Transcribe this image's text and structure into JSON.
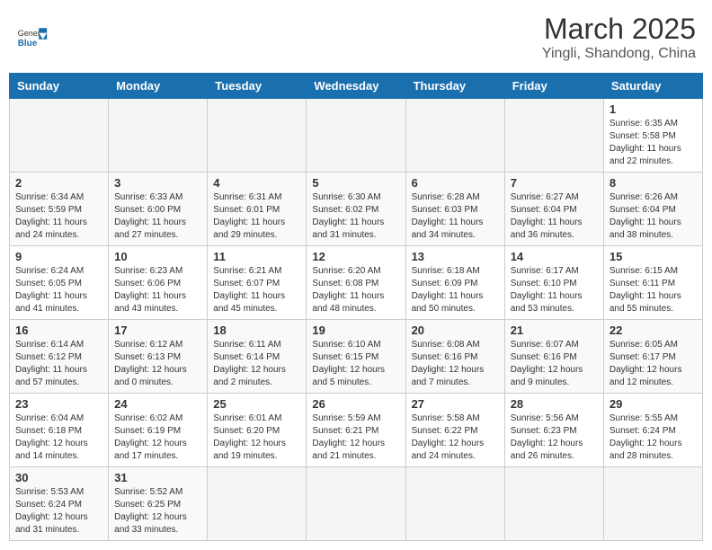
{
  "header": {
    "logo_general": "General",
    "logo_blue": "Blue",
    "month": "March 2025",
    "location": "Yingli, Shandong, China"
  },
  "days_of_week": [
    "Sunday",
    "Monday",
    "Tuesday",
    "Wednesday",
    "Thursday",
    "Friday",
    "Saturday"
  ],
  "weeks": [
    [
      {
        "day": "",
        "info": ""
      },
      {
        "day": "",
        "info": ""
      },
      {
        "day": "",
        "info": ""
      },
      {
        "day": "",
        "info": ""
      },
      {
        "day": "",
        "info": ""
      },
      {
        "day": "",
        "info": ""
      },
      {
        "day": "1",
        "info": "Sunrise: 6:35 AM\nSunset: 5:58 PM\nDaylight: 11 hours\nand 22 minutes."
      }
    ],
    [
      {
        "day": "2",
        "info": "Sunrise: 6:34 AM\nSunset: 5:59 PM\nDaylight: 11 hours\nand 24 minutes."
      },
      {
        "day": "3",
        "info": "Sunrise: 6:33 AM\nSunset: 6:00 PM\nDaylight: 11 hours\nand 27 minutes."
      },
      {
        "day": "4",
        "info": "Sunrise: 6:31 AM\nSunset: 6:01 PM\nDaylight: 11 hours\nand 29 minutes."
      },
      {
        "day": "5",
        "info": "Sunrise: 6:30 AM\nSunset: 6:02 PM\nDaylight: 11 hours\nand 31 minutes."
      },
      {
        "day": "6",
        "info": "Sunrise: 6:28 AM\nSunset: 6:03 PM\nDaylight: 11 hours\nand 34 minutes."
      },
      {
        "day": "7",
        "info": "Sunrise: 6:27 AM\nSunset: 6:04 PM\nDaylight: 11 hours\nand 36 minutes."
      },
      {
        "day": "8",
        "info": "Sunrise: 6:26 AM\nSunset: 6:04 PM\nDaylight: 11 hours\nand 38 minutes."
      }
    ],
    [
      {
        "day": "9",
        "info": "Sunrise: 6:24 AM\nSunset: 6:05 PM\nDaylight: 11 hours\nand 41 minutes."
      },
      {
        "day": "10",
        "info": "Sunrise: 6:23 AM\nSunset: 6:06 PM\nDaylight: 11 hours\nand 43 minutes."
      },
      {
        "day": "11",
        "info": "Sunrise: 6:21 AM\nSunset: 6:07 PM\nDaylight: 11 hours\nand 45 minutes."
      },
      {
        "day": "12",
        "info": "Sunrise: 6:20 AM\nSunset: 6:08 PM\nDaylight: 11 hours\nand 48 minutes."
      },
      {
        "day": "13",
        "info": "Sunrise: 6:18 AM\nSunset: 6:09 PM\nDaylight: 11 hours\nand 50 minutes."
      },
      {
        "day": "14",
        "info": "Sunrise: 6:17 AM\nSunset: 6:10 PM\nDaylight: 11 hours\nand 53 minutes."
      },
      {
        "day": "15",
        "info": "Sunrise: 6:15 AM\nSunset: 6:11 PM\nDaylight: 11 hours\nand 55 minutes."
      }
    ],
    [
      {
        "day": "16",
        "info": "Sunrise: 6:14 AM\nSunset: 6:12 PM\nDaylight: 11 hours\nand 57 minutes."
      },
      {
        "day": "17",
        "info": "Sunrise: 6:12 AM\nSunset: 6:13 PM\nDaylight: 12 hours\nand 0 minutes."
      },
      {
        "day": "18",
        "info": "Sunrise: 6:11 AM\nSunset: 6:14 PM\nDaylight: 12 hours\nand 2 minutes."
      },
      {
        "day": "19",
        "info": "Sunrise: 6:10 AM\nSunset: 6:15 PM\nDaylight: 12 hours\nand 5 minutes."
      },
      {
        "day": "20",
        "info": "Sunrise: 6:08 AM\nSunset: 6:16 PM\nDaylight: 12 hours\nand 7 minutes."
      },
      {
        "day": "21",
        "info": "Sunrise: 6:07 AM\nSunset: 6:16 PM\nDaylight: 12 hours\nand 9 minutes."
      },
      {
        "day": "22",
        "info": "Sunrise: 6:05 AM\nSunset: 6:17 PM\nDaylight: 12 hours\nand 12 minutes."
      }
    ],
    [
      {
        "day": "23",
        "info": "Sunrise: 6:04 AM\nSunset: 6:18 PM\nDaylight: 12 hours\nand 14 minutes."
      },
      {
        "day": "24",
        "info": "Sunrise: 6:02 AM\nSunset: 6:19 PM\nDaylight: 12 hours\nand 17 minutes."
      },
      {
        "day": "25",
        "info": "Sunrise: 6:01 AM\nSunset: 6:20 PM\nDaylight: 12 hours\nand 19 minutes."
      },
      {
        "day": "26",
        "info": "Sunrise: 5:59 AM\nSunset: 6:21 PM\nDaylight: 12 hours\nand 21 minutes."
      },
      {
        "day": "27",
        "info": "Sunrise: 5:58 AM\nSunset: 6:22 PM\nDaylight: 12 hours\nand 24 minutes."
      },
      {
        "day": "28",
        "info": "Sunrise: 5:56 AM\nSunset: 6:23 PM\nDaylight: 12 hours\nand 26 minutes."
      },
      {
        "day": "29",
        "info": "Sunrise: 5:55 AM\nSunset: 6:24 PM\nDaylight: 12 hours\nand 28 minutes."
      }
    ],
    [
      {
        "day": "30",
        "info": "Sunrise: 5:53 AM\nSunset: 6:24 PM\nDaylight: 12 hours\nand 31 minutes."
      },
      {
        "day": "31",
        "info": "Sunrise: 5:52 AM\nSunset: 6:25 PM\nDaylight: 12 hours\nand 33 minutes."
      },
      {
        "day": "",
        "info": ""
      },
      {
        "day": "",
        "info": ""
      },
      {
        "day": "",
        "info": ""
      },
      {
        "day": "",
        "info": ""
      },
      {
        "day": "",
        "info": ""
      }
    ]
  ]
}
